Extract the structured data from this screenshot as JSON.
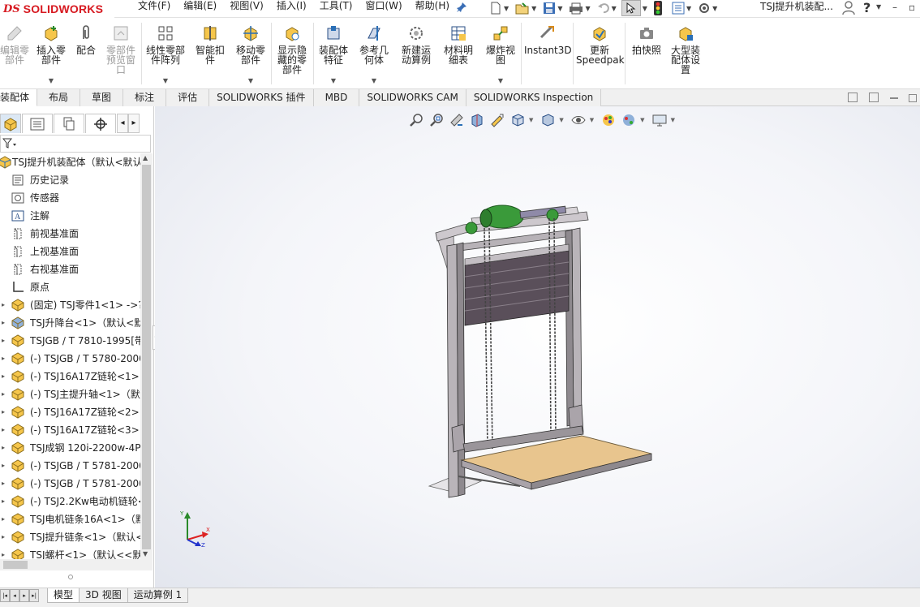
{
  "app": {
    "brand_prefix": "DS",
    "brand_name": "SOLIDWORKS",
    "document_title": "TSJ提升机装配..."
  },
  "menu": {
    "items": [
      "文件(F)",
      "编辑(E)",
      "视图(V)",
      "插入(I)",
      "工具(T)",
      "窗口(W)",
      "帮助(H)"
    ]
  },
  "quick_access": {
    "icons": [
      "new-icon",
      "open-icon",
      "save-icon",
      "print-icon",
      "undo-icon",
      "select-icon",
      "rebuild-icon",
      "file-properties-icon",
      "options-icon"
    ]
  },
  "command_manager": {
    "buttons": [
      {
        "line1": "编辑零",
        "line2": "部件",
        "line3": "",
        "disabled": true,
        "dropdown": false
      },
      {
        "line1": "插入零",
        "line2": "部件",
        "line3": "",
        "disabled": false,
        "dropdown": true
      },
      {
        "line1": "配合",
        "line2": "",
        "line3": "",
        "disabled": false,
        "dropdown": false
      },
      {
        "line1": "零部件",
        "line2": "预览窗",
        "line3": "口",
        "disabled": true,
        "dropdown": false
      },
      {
        "line1": "线性零部",
        "line2": "件阵列",
        "line3": "",
        "disabled": false,
        "dropdown": true
      },
      {
        "line1": "智能扣",
        "line2": "件",
        "line3": "",
        "disabled": false,
        "dropdown": false
      },
      {
        "line1": "移动零",
        "line2": "部件",
        "line3": "",
        "disabled": false,
        "dropdown": true
      },
      {
        "line1": "显示隐",
        "line2": "藏的零",
        "line3": "部件",
        "disabled": false,
        "dropdown": false
      },
      {
        "line1": "装配体",
        "line2": "特征",
        "line3": "",
        "disabled": false,
        "dropdown": true
      },
      {
        "line1": "参考几",
        "line2": "何体",
        "line3": "",
        "disabled": false,
        "dropdown": true
      },
      {
        "line1": "新建运",
        "line2": "动算例",
        "line3": "",
        "disabled": false,
        "dropdown": false
      },
      {
        "line1": "材料明",
        "line2": "细表",
        "line3": "",
        "disabled": false,
        "dropdown": false
      },
      {
        "line1": "爆炸视",
        "line2": "图",
        "line3": "",
        "disabled": false,
        "dropdown": true
      },
      {
        "line1": "Instant3D",
        "line2": "",
        "line3": "",
        "disabled": false,
        "dropdown": false
      },
      {
        "line1": "更新",
        "line2": "Speedpak",
        "line3": "",
        "disabled": false,
        "dropdown": false
      },
      {
        "line1": "拍快照",
        "line2": "",
        "line3": "",
        "disabled": false,
        "dropdown": false
      },
      {
        "line1": "大型装",
        "line2": "配体设",
        "line3": "置",
        "disabled": false,
        "dropdown": false
      }
    ]
  },
  "tabs": [
    {
      "label": "装配体",
      "active": true
    },
    {
      "label": "布局",
      "active": false
    },
    {
      "label": "草图",
      "active": false
    },
    {
      "label": "标注",
      "active": false
    },
    {
      "label": "评估",
      "active": false
    },
    {
      "label": "SOLIDWORKS 插件",
      "active": false
    },
    {
      "label": "MBD",
      "active": false
    },
    {
      "label": "SOLIDWORKS CAM",
      "active": false
    },
    {
      "label": "SOLIDWORKS Inspection",
      "active": false
    }
  ],
  "feature_tree": {
    "panel_tabs": [
      "featuremanager-tab",
      "propertymanager-tab",
      "configurationmanager-tab",
      "dimxpert-tab"
    ],
    "root": "TSJ提升机装配体（默认<默认",
    "items": [
      {
        "label": "历史记录",
        "icon": "history-icon"
      },
      {
        "label": "传感器",
        "icon": "sensor-icon"
      },
      {
        "label": "注解",
        "icon": "annotation-icon"
      },
      {
        "label": "前视基准面",
        "icon": "plane-icon"
      },
      {
        "label": "上视基准面",
        "icon": "plane-icon"
      },
      {
        "label": "右视基准面",
        "icon": "plane-icon"
      },
      {
        "label": "原点",
        "icon": "origin-icon"
      },
      {
        "label": "(固定) TSJ零件1<1> ->?",
        "icon": "part-icon",
        "expandable": true
      },
      {
        "label": "TSJ升降台<1>（默认<默认",
        "icon": "subassembly-icon",
        "expandable": true
      },
      {
        "label": "TSJGB / T 7810-1995[带",
        "icon": "part-icon",
        "expandable": true
      },
      {
        "label": "(-) TSJGB / T 5780-2000",
        "icon": "part-icon",
        "expandable": true
      },
      {
        "label": "(-) TSJ16A17Z链轮<1>（",
        "icon": "part-icon",
        "expandable": true
      },
      {
        "label": "(-) TSJ主提升轴<1>（默认",
        "icon": "part-icon",
        "expandable": true
      },
      {
        "label": "(-) TSJ16A17Z链轮<2>（",
        "icon": "part-icon",
        "expandable": true
      },
      {
        "label": "(-) TSJ16A17Z链轮<3>（",
        "icon": "part-icon",
        "expandable": true
      },
      {
        "label": "TSJ成钢 120i-2200w-4P-",
        "icon": "part-icon",
        "expandable": true
      },
      {
        "label": "(-) TSJGB / T 5781-2000",
        "icon": "part-icon",
        "expandable": true
      },
      {
        "label": "(-) TSJGB / T 5781-2000",
        "icon": "part-icon",
        "expandable": true
      },
      {
        "label": "(-) TSJ2.2Kw电动机链轮<",
        "icon": "part-icon",
        "expandable": true
      },
      {
        "label": "TSJ电机链条16A<1>（默",
        "icon": "part-icon",
        "expandable": true
      },
      {
        "label": "TSJ提升链条<1>（默认<",
        "icon": "part-icon",
        "expandable": true
      },
      {
        "label": "TSJ螺杆<1>（默认<<默认",
        "icon": "part-icon",
        "expandable": true
      }
    ]
  },
  "headsup_toolbar": {
    "icons": [
      "zoom-to-fit-icon",
      "zoom-to-area-icon",
      "previous-view-icon",
      "section-view-icon",
      "dynamic-annotation-icon",
      "view-orientation-icon",
      "display-style-icon",
      "hide-show-items-icon",
      "edit-appearance-icon",
      "apply-scene-icon",
      "view-settings-icon"
    ]
  },
  "triad": {
    "x": "X",
    "y": "Y",
    "z": "Z"
  },
  "colors": {
    "brand_red": "#d71920",
    "platform_wood": "#e8c58e",
    "frame_steel": "#b7b2b7",
    "motor_green": "#3a9a3a",
    "panel_dark": "#5a4f5a"
  },
  "bottom_tabs": [
    {
      "label": "模型",
      "active": true
    },
    {
      "label": "3D 视图",
      "active": false
    },
    {
      "label": "运动算例 1",
      "active": false
    }
  ]
}
